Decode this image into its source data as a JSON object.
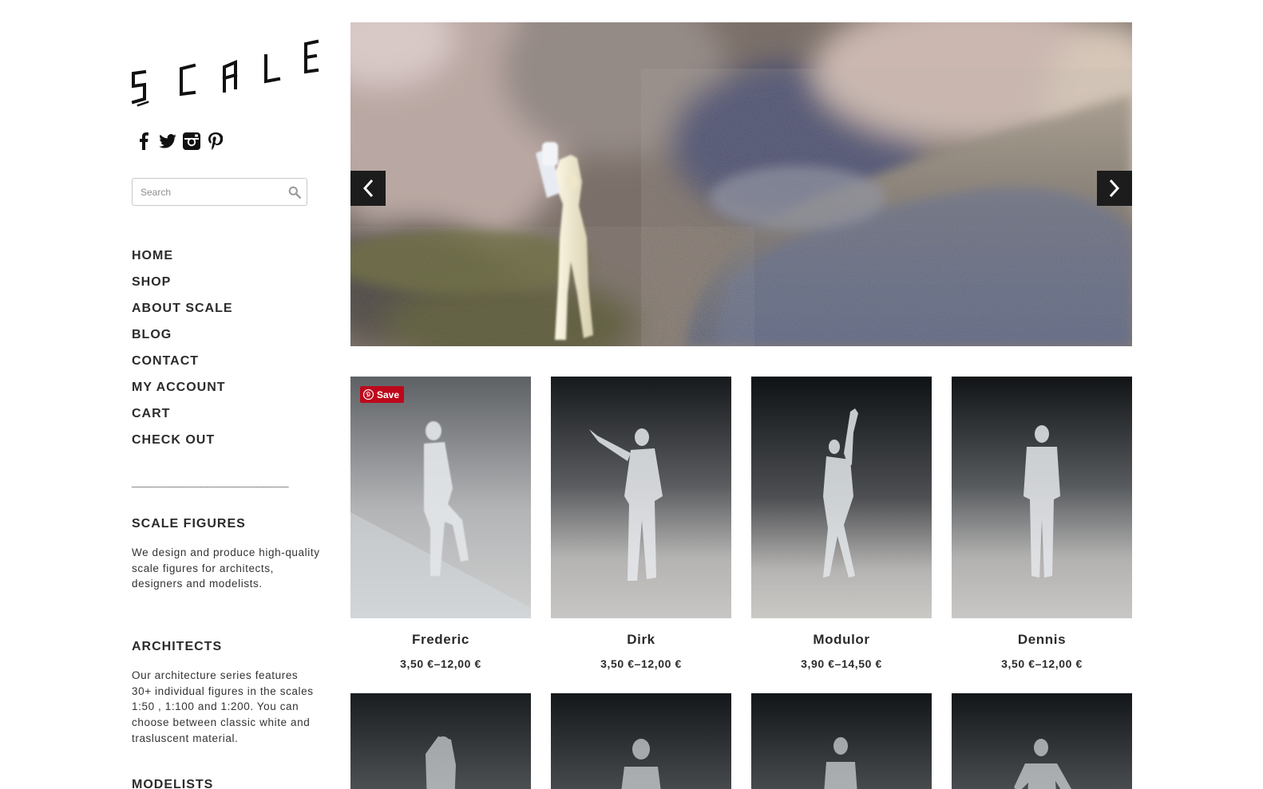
{
  "sidebar": {
    "logo_text": "SCALE",
    "social": [
      {
        "icon": "facebook-icon"
      },
      {
        "icon": "twitter-icon"
      },
      {
        "icon": "instagram-icon"
      },
      {
        "icon": "pinterest-icon"
      }
    ],
    "search": {
      "placeholder": "Search",
      "icon": "search-icon"
    },
    "nav": [
      "HOME",
      "SHOP",
      "ABOUT SCALE",
      "BLOG",
      "CONTACT",
      "MY ACCOUNT",
      "CART",
      "CHECK OUT"
    ],
    "divider": "_________________________",
    "widgets": [
      {
        "title": "SCALE FIGURES",
        "text": "We design and produce high-quality scale figures for architects, designers and modelists."
      },
      {
        "title": "ARCHITECTS",
        "text": "Our architecture series features 30+ individual figures in the scales 1:50 , 1:100 and 1:200. You can choose between classic white and trasluscent material."
      },
      {
        "title": "MODELISTS",
        "text": ""
      }
    ]
  },
  "slider": {
    "prev_icon": "chevron-left-icon",
    "next_icon": "chevron-right-icon"
  },
  "products": [
    {
      "name": "Frederic",
      "price": "3,50 €–12,00 €",
      "save_label": "Save"
    },
    {
      "name": "Dirk",
      "price": "3,50 €–12,00 €"
    },
    {
      "name": "Modulor",
      "price": "3,90 €–14,50 €"
    },
    {
      "name": "Dennis",
      "price": "3,50 €–12,00 €"
    }
  ],
  "colors": {
    "text": "#2b2b2b",
    "pinterest": "#bd081c",
    "arrow_bg": "#1c1c1c"
  }
}
